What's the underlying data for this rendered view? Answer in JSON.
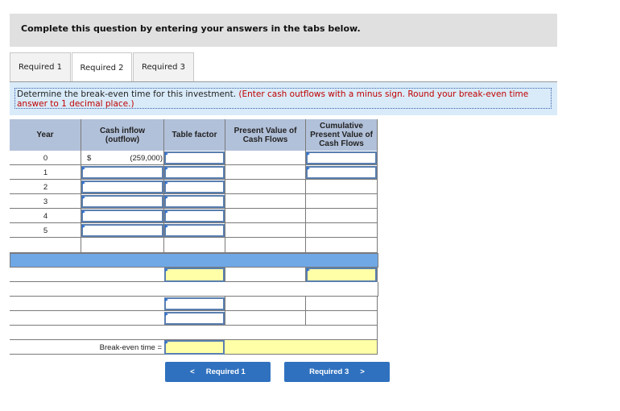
{
  "instruction": "Complete this question by entering your answers in the tabs below.",
  "tabs": [
    {
      "label": "Required 1",
      "active": false
    },
    {
      "label": "Required 2",
      "active": true
    },
    {
      "label": "Required 3",
      "active": false
    }
  ],
  "question": {
    "text": "Determine the break-even time for this investment.",
    "hint": "(Enter cash outflows with a minus sign. Round your break-even time answer to 1 decimal place.)"
  },
  "table": {
    "headers": [
      "Year",
      "Cash inflow (outflow)",
      "Table factor",
      "Present Value of Cash Flows",
      "Cumulative Present Value of Cash Flows"
    ],
    "years": [
      "0",
      "1",
      "2",
      "3",
      "4",
      "5"
    ],
    "row0_currency": "$",
    "row0_cash_flow": "(259,000)",
    "break_even_label": "Break-even time ="
  },
  "nav": {
    "prev_label": "Required 1",
    "prev_icon": "<",
    "next_label": "Required 3",
    "next_icon": ">"
  },
  "colors": {
    "header_bg": "#b2c1da",
    "highlight_bar": "#70a8e6",
    "answer_yellow": "#ffffa8",
    "button_blue": "#2f71bf",
    "hint_red": "#c00000"
  }
}
